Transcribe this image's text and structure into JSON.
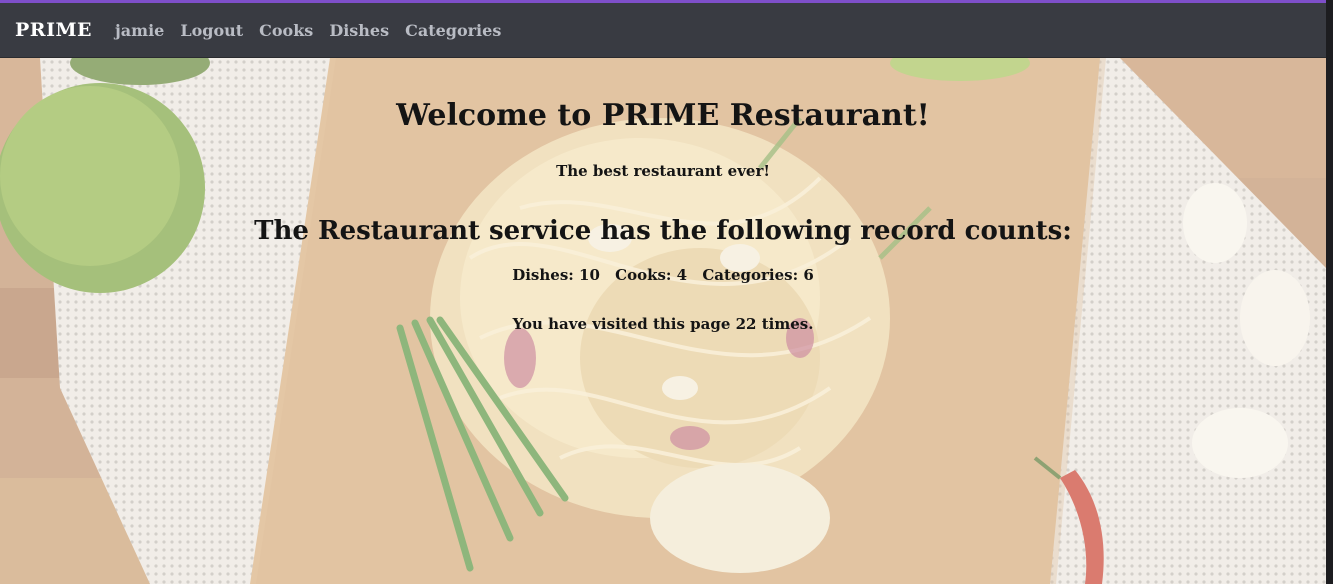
{
  "navbar": {
    "brand": "PRIME",
    "links": [
      {
        "label": "jamie"
      },
      {
        "label": "Logout"
      },
      {
        "label": "Cooks"
      },
      {
        "label": "Dishes"
      },
      {
        "label": "Categories"
      }
    ]
  },
  "main": {
    "title": "Welcome to PRIME Restaurant!",
    "subtitle": "The best restaurant ever!",
    "counts_heading": "The Restaurant service has the following record counts:",
    "counts": {
      "dishes": "Dishes: 10",
      "cooks": "Cooks: 4",
      "categories": "Categories: 6"
    },
    "visits": "You have visited this page 22 times."
  },
  "colors": {
    "accent": "#7e4fc9",
    "navbar_bg": "#393b42",
    "nav_link": "#b9bcc4",
    "brand": "#ffffff"
  },
  "background_image": {
    "description_icon": "food-photo"
  }
}
